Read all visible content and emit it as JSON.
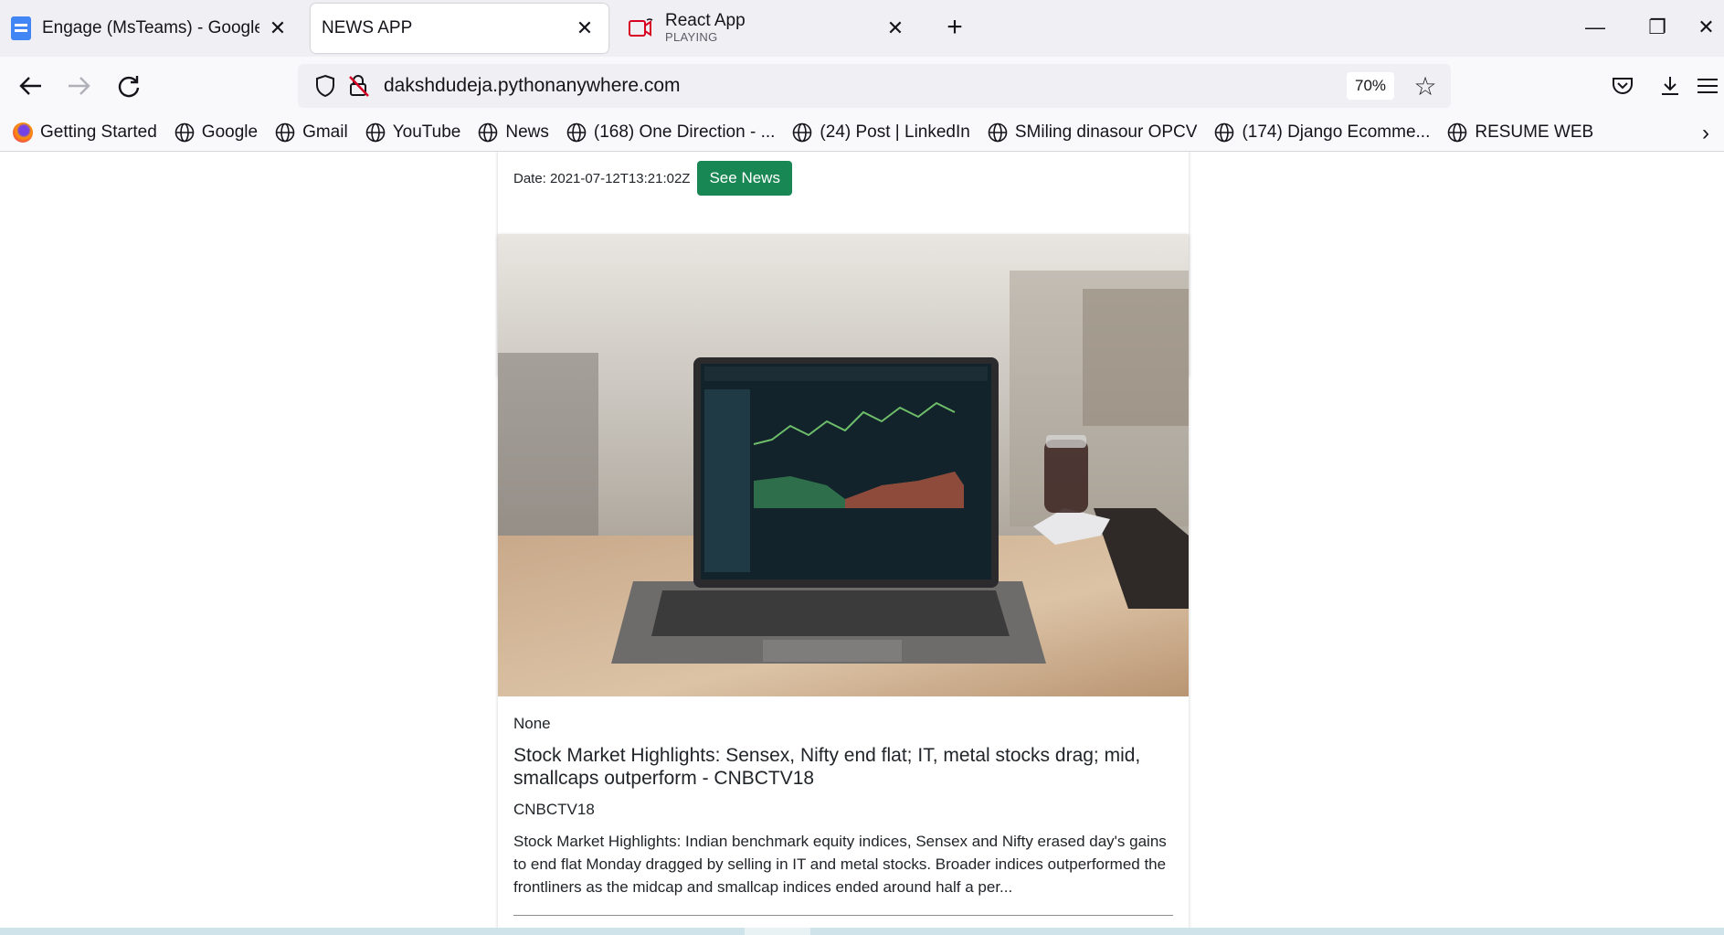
{
  "tabs": [
    {
      "title": "Engage (MsTeams) - Google Do",
      "active": false,
      "icon": "google-docs-icon"
    },
    {
      "title": "NEWS APP",
      "active": true
    },
    {
      "title": "React App",
      "subtitle": "PLAYING",
      "active": false,
      "icon": "camera-audio-icon"
    }
  ],
  "nav": {
    "url": "dakshdudeja.pythonanywhere.com",
    "zoom": "70%"
  },
  "bookmarks": [
    {
      "label": "Getting Started",
      "icon": "firefox-icon"
    },
    {
      "label": "Google",
      "icon": "globe-icon"
    },
    {
      "label": "Gmail",
      "icon": "globe-icon"
    },
    {
      "label": "YouTube",
      "icon": "globe-icon"
    },
    {
      "label": "News",
      "icon": "globe-icon"
    },
    {
      "label": "(168) One Direction - ...",
      "icon": "globe-icon"
    },
    {
      "label": "(24) Post | LinkedIn",
      "icon": "globe-icon"
    },
    {
      "label": "SMiling dinasour OPCV",
      "icon": "globe-icon"
    },
    {
      "label": "(174) Django Ecomme...",
      "icon": "globe-icon"
    },
    {
      "label": "RESUME WEB",
      "icon": "globe-icon"
    }
  ],
  "page": {
    "previous_card": {
      "date": "Date: 2021-07-12T13:21:02Z",
      "button": "See News"
    },
    "card": {
      "author": "None",
      "headline": "Stock Market Highlights: Sensex, Nifty end flat; IT, metal stocks drag; mid, smallcaps outperform - CNBCTV18",
      "source": "CNBCTV18",
      "description": "Stock Market Highlights: Indian benchmark equity indices, Sensex and Nifty erased day's gains to end flat Monday dragged by selling in IT and metal stocks. Broader indices outperformed the frontliners as the midcap and smallcap indices ended around half a per..."
    }
  },
  "colors": {
    "accent_green": "#198754",
    "tabstrip": "#f0f0f4"
  }
}
